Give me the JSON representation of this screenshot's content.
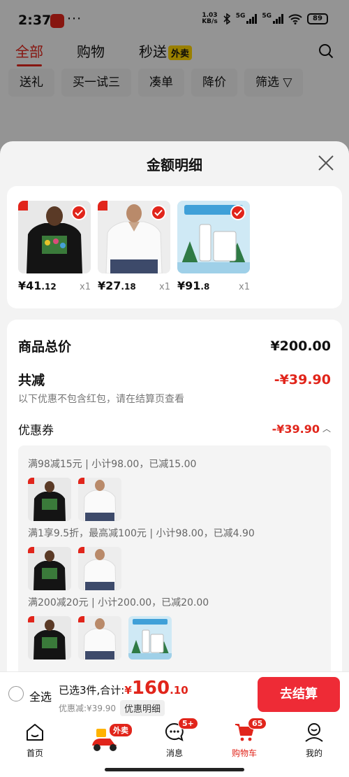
{
  "status_bar": {
    "time": "2:37",
    "dots": "···",
    "speed_top": "1.03",
    "speed_bottom": "KB/s",
    "network1": "5G",
    "network2": "5G",
    "battery": "89"
  },
  "top_tabs": [
    {
      "label": "全部"
    },
    {
      "label": "购物"
    },
    {
      "label": "秒送",
      "tag": "外卖"
    }
  ],
  "filters": [
    "送礼",
    "买一试三",
    "凑单",
    "降价",
    "筛选"
  ],
  "sheet": {
    "title": "金额明细",
    "items": [
      {
        "price_int": "¥41",
        "price_dec": ".12",
        "qty": "x1"
      },
      {
        "price_int": "¥27",
        "price_dec": ".18",
        "qty": "x1"
      },
      {
        "price_int": "¥91",
        "price_dec": ".8",
        "qty": "x1"
      }
    ],
    "summary": {
      "total_label": "商品总价",
      "total_value": "¥200.00",
      "reduce_label": "共减",
      "reduce_value": "-¥39.90",
      "reduce_note": "以下优惠不包含红包，请在结算页查看",
      "coupon_label": "优惠券",
      "coupon_value": "-¥39.90",
      "coupon_lines": [
        "满98减15元 | 小计98.00，已减15.00",
        "满1享9.5折，最高减100元 | 小计98.00，已减4.90",
        "满200减20元 | 小计200.00，已减20.00"
      ]
    }
  },
  "checkout": {
    "select_all": "全选",
    "selected_text": "已选3件,合计:",
    "total_yen": "¥",
    "total_int": "160",
    "total_dec": ".10",
    "discount_text": "优惠减:¥39.90",
    "detail_label": "优惠明细",
    "button": "去结算"
  },
  "tabbar": [
    {
      "label": "首页",
      "icon": "home-icon"
    },
    {
      "label": "",
      "icon": "scooter-icon",
      "badge": "外卖"
    },
    {
      "label": "消息",
      "icon": "message-icon",
      "badge": "5+"
    },
    {
      "label": "购物车",
      "icon": "cart-icon",
      "badge": "65"
    },
    {
      "label": "我的",
      "icon": "profile-icon"
    }
  ],
  "colors": {
    "accent": "#e1251b",
    "button": "#ee2b36",
    "tag_yellow": "#ffd400"
  }
}
